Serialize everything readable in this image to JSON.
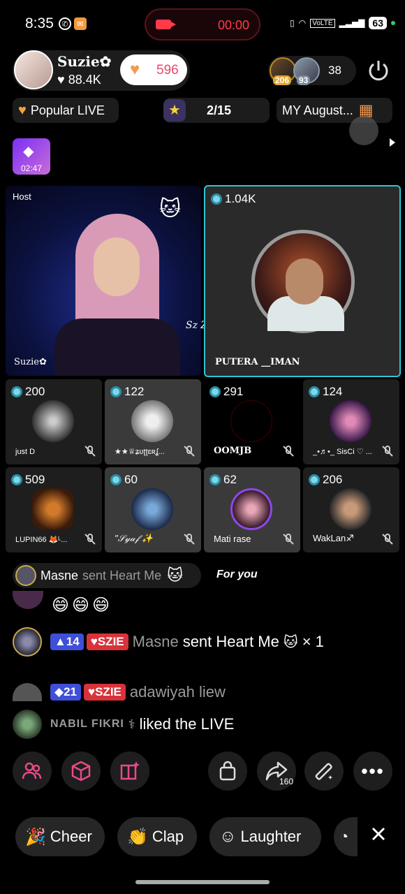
{
  "status": {
    "time": "8:35",
    "recording_time": "00:00",
    "network": "VoLTE",
    "battery": "63"
  },
  "host": {
    "name": "Suzie✿",
    "likes": "88.4K",
    "heart_count": "596"
  },
  "viewers": {
    "badge_1": "206",
    "badge_2": "93",
    "count": "38"
  },
  "pills": {
    "popular": "Popular LIVE",
    "rank": "2/15",
    "event": "MY August..."
  },
  "mini_timer": "02:47",
  "main_tiles": {
    "host_tag": "Host",
    "host_label": "Suzie✿",
    "watermark": "Sz Zir✿",
    "guest_count": "1.04K",
    "guest_name": "PUTERA __IMAN"
  },
  "seats": [
    {
      "count": "200",
      "name": "just D"
    },
    {
      "count": "122",
      "name": "★★♕ʑʋʈʈɛʀʆ..."
    },
    {
      "count": "291",
      "name": "OOMJB"
    },
    {
      "count": "124",
      "name": "_•♬•_ SisCi ♡ ..."
    },
    {
      "count": "509",
      "name": "LUPIN66 🦊ᴸ..."
    },
    {
      "count": "60",
      "name": "\"𝒮𝓎𝒶𝒻 ✨"
    },
    {
      "count": "62",
      "name": "Mati rase"
    },
    {
      "count": "206",
      "name": "WakLan♐"
    }
  ],
  "gift_banner": {
    "user": "Masne",
    "text": "sent Heart Me"
  },
  "for_you": "For you",
  "chat": [
    {
      "emojis": "😄😄😄"
    },
    {
      "level": "14",
      "club": "SZIE",
      "user": "Masne",
      "message": "sent Heart Me",
      "suffix": "× 1"
    },
    {
      "level": "21",
      "club": "SZIE",
      "user": "adawiyah liew"
    },
    {
      "user": "NABIL FIKRI",
      "message": "liked the LIVE"
    }
  ],
  "share_count": "160",
  "reactions": {
    "cheer": "Cheer",
    "clap": "Clap",
    "laughter": "Laughter"
  },
  "colors": {
    "accent_pink": "#e84a6a",
    "guest_border": "#2ec4d8",
    "level_blue": "#3f4fd8",
    "club_red": "#d8323a"
  }
}
